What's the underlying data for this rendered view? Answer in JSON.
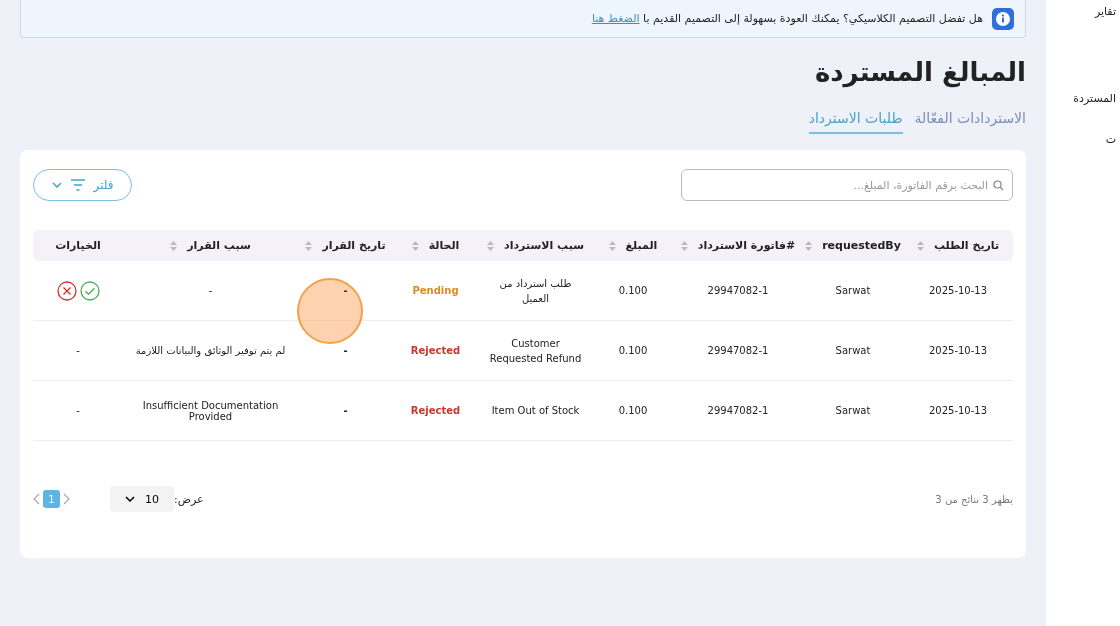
{
  "banner": {
    "text": "هل تفضل التصميم الكلاسيكي؟ يمكنك العودة بسهولة إلى التصميم القديم با",
    "link": "الضغط هنا"
  },
  "page_title": "المبالغ المستردة",
  "tabs": [
    {
      "label": "الاستردادات الفعّالة",
      "selected": false
    },
    {
      "label": "طلبات الاسترداد",
      "selected": true
    }
  ],
  "search": {
    "placeholder": "البحث برقم الفاتورة، المبلغ..."
  },
  "filter_button": "فلتر",
  "table": {
    "columns": [
      {
        "label": "تاريخ الطلب",
        "sortable": true
      },
      {
        "label": "requestedBy",
        "sortable": true
      },
      {
        "label": "#فاتورة الاسترداد",
        "sortable": true
      },
      {
        "label": "المبلغ",
        "sortable": true
      },
      {
        "label": "سبب الاسترداد",
        "sortable": true
      },
      {
        "label": "الحالة",
        "sortable": true
      },
      {
        "label": "تاريخ القرار",
        "sortable": true
      },
      {
        "label": "سبب القرار",
        "sortable": true
      },
      {
        "label": "الخيارات",
        "sortable": false
      }
    ],
    "rows": [
      {
        "request_date": "2025-10-13",
        "requested_by": "Sarwat",
        "invoice": "29947082-1",
        "amount": "0.100",
        "reason": "طلب استرداد من العميل",
        "status": "Pending",
        "kind": "pending",
        "decision_date": "-",
        "decision_reason": "-",
        "options": {
          "kind": "actions"
        }
      },
      {
        "request_date": "2025-10-13",
        "requested_by": "Sarwat",
        "invoice": "29947082-1",
        "amount": "0.100",
        "reason": "Customer Requested Refund",
        "status": "Rejected",
        "kind": "rejected",
        "decision_date": "-",
        "decision_reason": "لم يتم توفير الوثائق والبيانات اللازمة",
        "options": {
          "kind": "text",
          "text": "-"
        }
      },
      {
        "request_date": "2025-10-13",
        "requested_by": "Sarwat",
        "invoice": "29947082-1",
        "amount": "0.100",
        "reason": "Item Out of Stock",
        "status": "Rejected",
        "kind": "rejected",
        "decision_date": "-",
        "decision_reason": "Insufficient Documentation Provided",
        "options": {
          "kind": "text",
          "text": "-"
        }
      }
    ]
  },
  "footer": {
    "summary": "يظهر 3 نتائج من 3",
    "page_size_label": "عرض:",
    "page_size": "10",
    "pages": [
      {
        "label": "1",
        "selected": true
      }
    ]
  },
  "sidebar": {
    "items": [
      "تقاير",
      "المستردة",
      "ت"
    ]
  }
}
